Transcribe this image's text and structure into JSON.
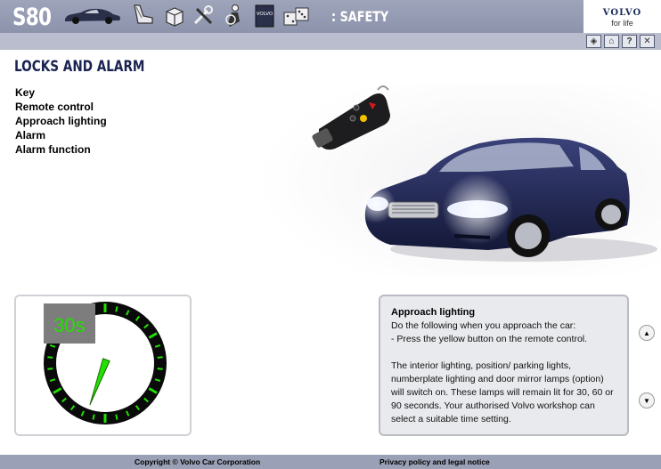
{
  "header": {
    "model": "S80",
    "section": ": SAFETY",
    "brand_name": "VOLVO",
    "brand_tagline": "for life",
    "nav_icons": [
      "car-icon",
      "seat-icon",
      "box-icon",
      "tools-icon",
      "driver-icon",
      "book-icon",
      "dice-icon"
    ],
    "book_label": "VOLVO"
  },
  "toolbar": {
    "buttons": [
      {
        "name": "back-button",
        "label": "◈"
      },
      {
        "name": "home-button",
        "label": "⌂"
      },
      {
        "name": "help-button",
        "label": "?"
      },
      {
        "name": "close-button",
        "label": "✕"
      }
    ]
  },
  "page": {
    "title": "LOCKS AND ALARM"
  },
  "menu": {
    "items": [
      "Key",
      "Remote control",
      "Approach lighting",
      "Alarm",
      "Alarm function"
    ]
  },
  "timer": {
    "label": "30s",
    "ticks": 30,
    "hand_angle_deg": 200,
    "accent": "#22e000"
  },
  "info": {
    "title": "Approach lighting",
    "text": "Do the following when you approach the car:\n- Press the yellow button on the remote control.\n\nThe interior lighting, position/ parking lights, numberplate lighting and door mirror lamps (option) will switch on. These lamps will remain lit for 30, 60 or 90 seconds. Your authorised Volvo workshop can select a suitable time setting."
  },
  "footer": {
    "copyright": "Copyright © Volvo Car Corporation",
    "privacy": "Privacy policy and legal notice"
  },
  "colors": {
    "header": "#8c93ab",
    "car_body": "#1f2555",
    "key_button": "#f2c200"
  }
}
